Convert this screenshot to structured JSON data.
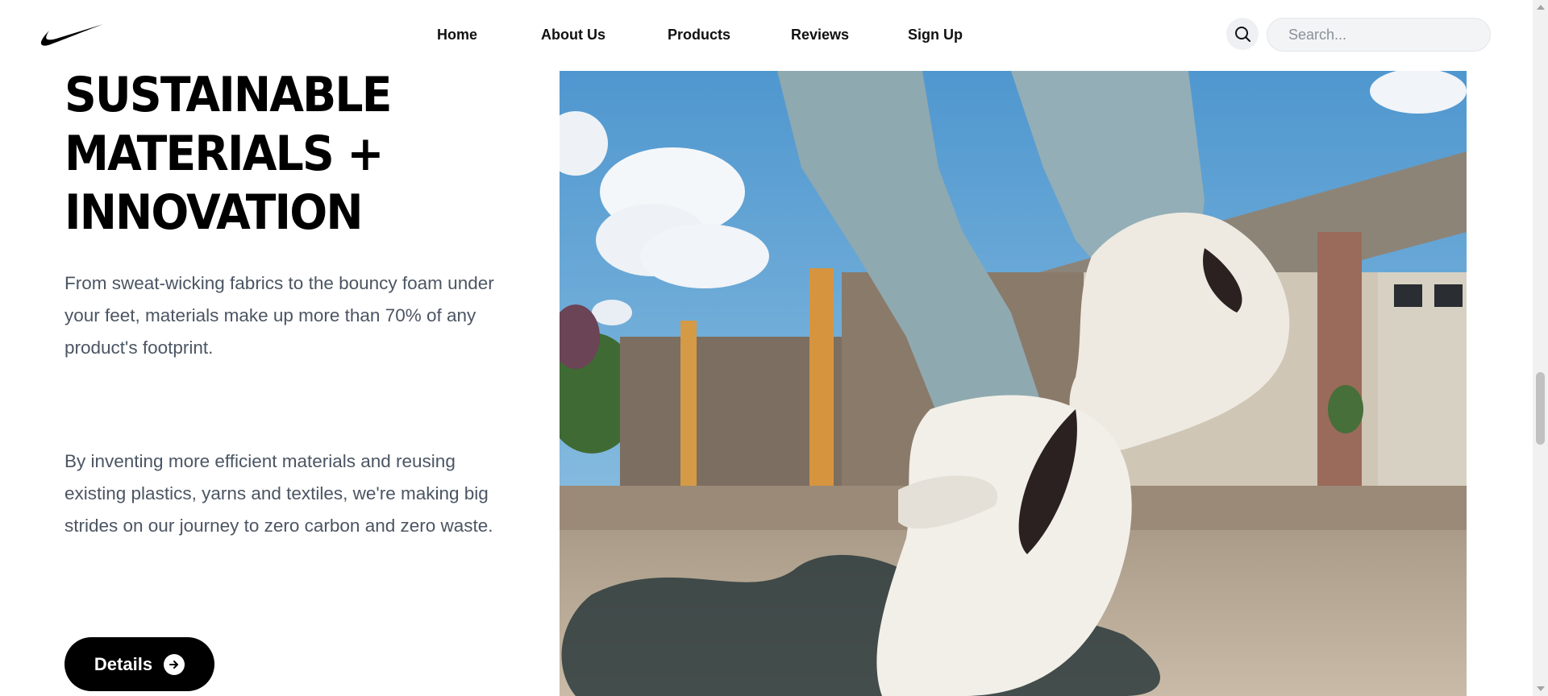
{
  "header": {
    "nav": [
      {
        "label": "Home"
      },
      {
        "label": "About Us"
      },
      {
        "label": "Products"
      },
      {
        "label": "Reviews"
      },
      {
        "label": "Sign Up"
      }
    ],
    "search": {
      "placeholder": "Search..."
    },
    "logo_icon": "swoosh-icon",
    "search_icon": "search-icon"
  },
  "hero": {
    "title_lines": [
      "SUSTAINABLE",
      "MATERIALS +",
      "INNOVATION"
    ],
    "paragraph_1": "From sweat-wicking fabrics to the bouncy foam under your feet, materials make up more than 70% of any product's footprint.",
    "paragraph_2": "By inventing more efficient materials and reusing existing plastics, yarns and textiles, we're making big strides on our journey to zero carbon and zero waste.",
    "details_label": "Details",
    "details_icon": "arrow-right-circle-icon"
  },
  "colors": {
    "primary": "#000000",
    "text_muted": "#4b5563",
    "search_bg": "#f2f4f6"
  }
}
